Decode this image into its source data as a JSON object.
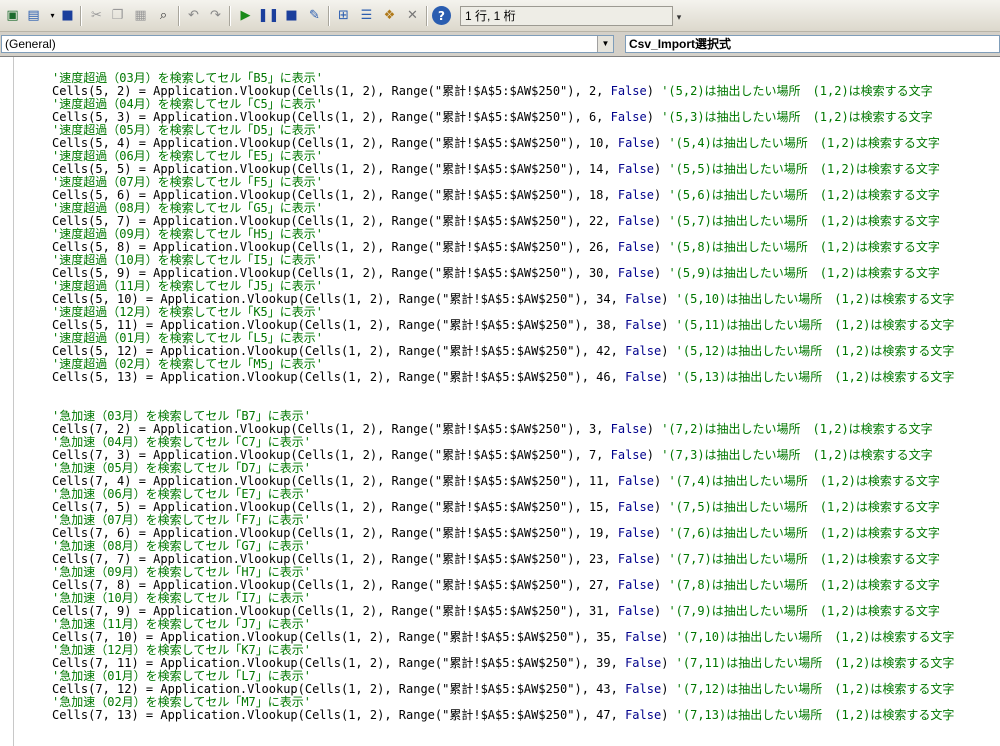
{
  "toolbar": {
    "position_text": "1 行, 1 桁"
  },
  "combos": {
    "object": "(General)",
    "procedure": "Csv_Import選択式"
  },
  "code": {
    "block1": [
      {
        "comment": "'速度超過（03月）を検索してセル「B5」に表示'",
        "pre": "Cells(5, 2) = Application.Vlookup(Cells(1, 2), Range(\"累計!$A$5:$AW$250\"), 2, ",
        "kw": "False",
        "post": ") ",
        "note": "'(5,2)は抽出したい場所　(1,2)は検索する文字"
      },
      {
        "comment": "'速度超過（04月）を検索してセル「C5」に表示'",
        "pre": "Cells(5, 3) = Application.Vlookup(Cells(1, 2), Range(\"累計!$A$5:$AW$250\"), 6, ",
        "kw": "False",
        "post": ") ",
        "note": "'(5,3)は抽出したい場所　(1,2)は検索する文字"
      },
      {
        "comment": "'速度超過（05月）を検索してセル「D5」に表示'",
        "pre": "Cells(5, 4) = Application.Vlookup(Cells(1, 2), Range(\"累計!$A$5:$AW$250\"), 10, ",
        "kw": "False",
        "post": ") ",
        "note": "'(5,4)は抽出したい場所　(1,2)は検索する文字"
      },
      {
        "comment": "'速度超過（06月）を検索してセル「E5」に表示'",
        "pre": "Cells(5, 5) = Application.Vlookup(Cells(1, 2), Range(\"累計!$A$5:$AW$250\"), 14, ",
        "kw": "False",
        "post": ") ",
        "note": "'(5,5)は抽出したい場所　(1,2)は検索する文字"
      },
      {
        "comment": "'速度超過（07月）を検索してセル「F5」に表示'",
        "pre": "Cells(5, 6) = Application.Vlookup(Cells(1, 2), Range(\"累計!$A$5:$AW$250\"), 18, ",
        "kw": "False",
        "post": ") ",
        "note": "'(5,6)は抽出したい場所　(1,2)は検索する文字"
      },
      {
        "comment": "'速度超過（08月）を検索してセル「G5」に表示'",
        "pre": "Cells(5, 7) = Application.Vlookup(Cells(1, 2), Range(\"累計!$A$5:$AW$250\"), 22, ",
        "kw": "False",
        "post": ") ",
        "note": "'(5,7)は抽出したい場所　(1,2)は検索する文字"
      },
      {
        "comment": "'速度超過（09月）を検索してセル「H5」に表示'",
        "pre": "Cells(5, 8) = Application.Vlookup(Cells(1, 2), Range(\"累計!$A$5:$AW$250\"), 26, ",
        "kw": "False",
        "post": ") ",
        "note": "'(5,8)は抽出したい場所　(1,2)は検索する文字"
      },
      {
        "comment": "'速度超過（10月）を検索してセル「I5」に表示'",
        "pre": "Cells(5, 9) = Application.Vlookup(Cells(1, 2), Range(\"累計!$A$5:$AW$250\"), 30, ",
        "kw": "False",
        "post": ") ",
        "note": "'(5,9)は抽出したい場所　(1,2)は検索する文字"
      },
      {
        "comment": "'速度超過（11月）を検索してセル「J5」に表示'",
        "pre": "Cells(5, 10) = Application.Vlookup(Cells(1, 2), Range(\"累計!$A$5:$AW$250\"), 34, ",
        "kw": "False",
        "post": ") ",
        "note": "'(5,10)は抽出したい場所　(1,2)は検索する文字"
      },
      {
        "comment": "'速度超過（12月）を検索してセル「K5」に表示'",
        "pre": "Cells(5, 11) = Application.Vlookup(Cells(1, 2), Range(\"累計!$A$5:$AW$250\"), 38, ",
        "kw": "False",
        "post": ") ",
        "note": "'(5,11)は抽出したい場所　(1,2)は検索する文字"
      },
      {
        "comment": "'速度超過（01月）を検索してセル「L5」に表示'",
        "pre": "Cells(5, 12) = Application.Vlookup(Cells(1, 2), Range(\"累計!$A$5:$AW$250\"), 42, ",
        "kw": "False",
        "post": ") ",
        "note": "'(5,12)は抽出したい場所　(1,2)は検索する文字"
      },
      {
        "comment": "'速度超過（02月）を検索してセル「M5」に表示'",
        "pre": "Cells(5, 13) = Application.Vlookup(Cells(1, 2), Range(\"累計!$A$5:$AW$250\"), 46, ",
        "kw": "False",
        "post": ") ",
        "note": "'(5,13)は抽出したい場所　(1,2)は検索する文字"
      }
    ],
    "block2": [
      {
        "comment": "'急加速（03月）を検索してセル「B7」に表示'",
        "pre": "Cells(7, 2) = Application.Vlookup(Cells(1, 2), Range(\"累計!$A$5:$AW$250\"), 3, ",
        "kw": "False",
        "post": ") ",
        "note": "'(7,2)は抽出したい場所　(1,2)は検索する文字"
      },
      {
        "comment": "'急加速（04月）を検索してセル「C7」に表示'",
        "pre": "Cells(7, 3) = Application.Vlookup(Cells(1, 2), Range(\"累計!$A$5:$AW$250\"), 7, ",
        "kw": "False",
        "post": ") ",
        "note": "'(7,3)は抽出したい場所　(1,2)は検索する文字"
      },
      {
        "comment": "'急加速（05月）を検索してセル「D7」に表示'",
        "pre": "Cells(7, 4) = Application.Vlookup(Cells(1, 2), Range(\"累計!$A$5:$AW$250\"), 11, ",
        "kw": "False",
        "post": ") ",
        "note": "'(7,4)は抽出したい場所　(1,2)は検索する文字"
      },
      {
        "comment": "'急加速（06月）を検索してセル「E7」に表示'",
        "pre": "Cells(7, 5) = Application.Vlookup(Cells(1, 2), Range(\"累計!$A$5:$AW$250\"), 15, ",
        "kw": "False",
        "post": ") ",
        "note": "'(7,5)は抽出したい場所　(1,2)は検索する文字"
      },
      {
        "comment": "'急加速（07月）を検索してセル「F7」に表示'",
        "pre": "Cells(7, 6) = Application.Vlookup(Cells(1, 2), Range(\"累計!$A$5:$AW$250\"), 19, ",
        "kw": "False",
        "post": ") ",
        "note": "'(7,6)は抽出したい場所　(1,2)は検索する文字"
      },
      {
        "comment": "'急加速（08月）を検索してセル「G7」に表示'",
        "pre": "Cells(7, 7) = Application.Vlookup(Cells(1, 2), Range(\"累計!$A$5:$AW$250\"), 23, ",
        "kw": "False",
        "post": ") ",
        "note": "'(7,7)は抽出したい場所　(1,2)は検索する文字"
      },
      {
        "comment": "'急加速（09月）を検索してセル「H7」に表示'",
        "pre": "Cells(7, 8) = Application.Vlookup(Cells(1, 2), Range(\"累計!$A$5:$AW$250\"), 27, ",
        "kw": "False",
        "post": ") ",
        "note": "'(7,8)は抽出したい場所　(1,2)は検索する文字"
      },
      {
        "comment": "'急加速（10月）を検索してセル「I7」に表示'",
        "pre": "Cells(7, 9) = Application.Vlookup(Cells(1, 2), Range(\"累計!$A$5:$AW$250\"), 31, ",
        "kw": "False",
        "post": ") ",
        "note": "'(7,9)は抽出したい場所　(1,2)は検索する文字"
      },
      {
        "comment": "'急加速（11月）を検索してセル「J7」に表示'",
        "pre": "Cells(7, 10) = Application.Vlookup(Cells(1, 2), Range(\"累計!$A$5:$AW$250\"), 35, ",
        "kw": "False",
        "post": ") ",
        "note": "'(7,10)は抽出したい場所　(1,2)は検索する文字"
      },
      {
        "comment": "'急加速（12月）を検索してセル「K7」に表示'",
        "pre": "Cells(7, 11) = Application.Vlookup(Cells(1, 2), Range(\"累計!$A$5:$AW$250\"), 39, ",
        "kw": "False",
        "post": ") ",
        "note": "'(7,11)は抽出したい場所　(1,2)は検索する文字"
      },
      {
        "comment": "'急加速（01月）を検索してセル「L7」に表示'",
        "pre": "Cells(7, 12) = Application.Vlookup(Cells(1, 2), Range(\"累計!$A$5:$AW$250\"), 43, ",
        "kw": "False",
        "post": ") ",
        "note": "'(7,12)は抽出したい場所　(1,2)は検索する文字"
      },
      {
        "comment": "'急加速（02月）を検索してセル「M7」に表示'",
        "pre": "Cells(7, 13) = Application.Vlookup(Cells(1, 2), Range(\"累計!$A$5:$AW$250\"), 47, ",
        "kw": "False",
        "post": ") ",
        "note": "'(7,13)は抽出したい場所　(1,2)は検索する文字"
      }
    ]
  }
}
